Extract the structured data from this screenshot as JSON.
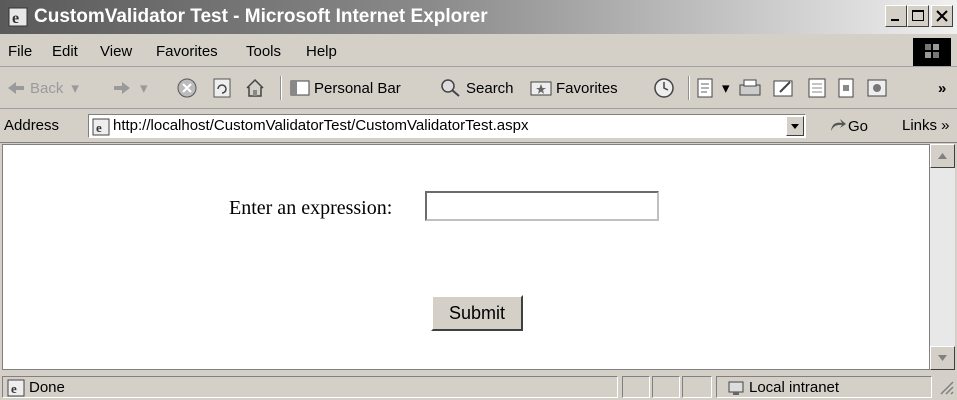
{
  "window": {
    "title": "CustomValidator Test - Microsoft Internet Explorer",
    "controls": {
      "minimize_icon": "minimize-icon",
      "maximize_icon": "maximize-icon",
      "close_icon": "close-icon"
    }
  },
  "menu": {
    "items": [
      "File",
      "Edit",
      "View",
      "Favorites",
      "Tools",
      "Help"
    ]
  },
  "toolbar": {
    "back": "Back",
    "personal_bar": "Personal Bar",
    "search": "Search",
    "favorites": "Favorites",
    "chevron": "»"
  },
  "address": {
    "label": "Address",
    "url": "http://localhost/CustomValidatorTest/CustomValidatorTest.aspx",
    "go": "Go",
    "links": "Links »"
  },
  "page": {
    "prompt": "Enter an expression:",
    "input_value": "",
    "submit": "Submit"
  },
  "status": {
    "text": "Done",
    "zone": "Local intranet"
  },
  "colors": {
    "chrome": "#d4d0c8",
    "titlebar_start": "#5a5a5a",
    "content_bg": "#ffffff"
  }
}
